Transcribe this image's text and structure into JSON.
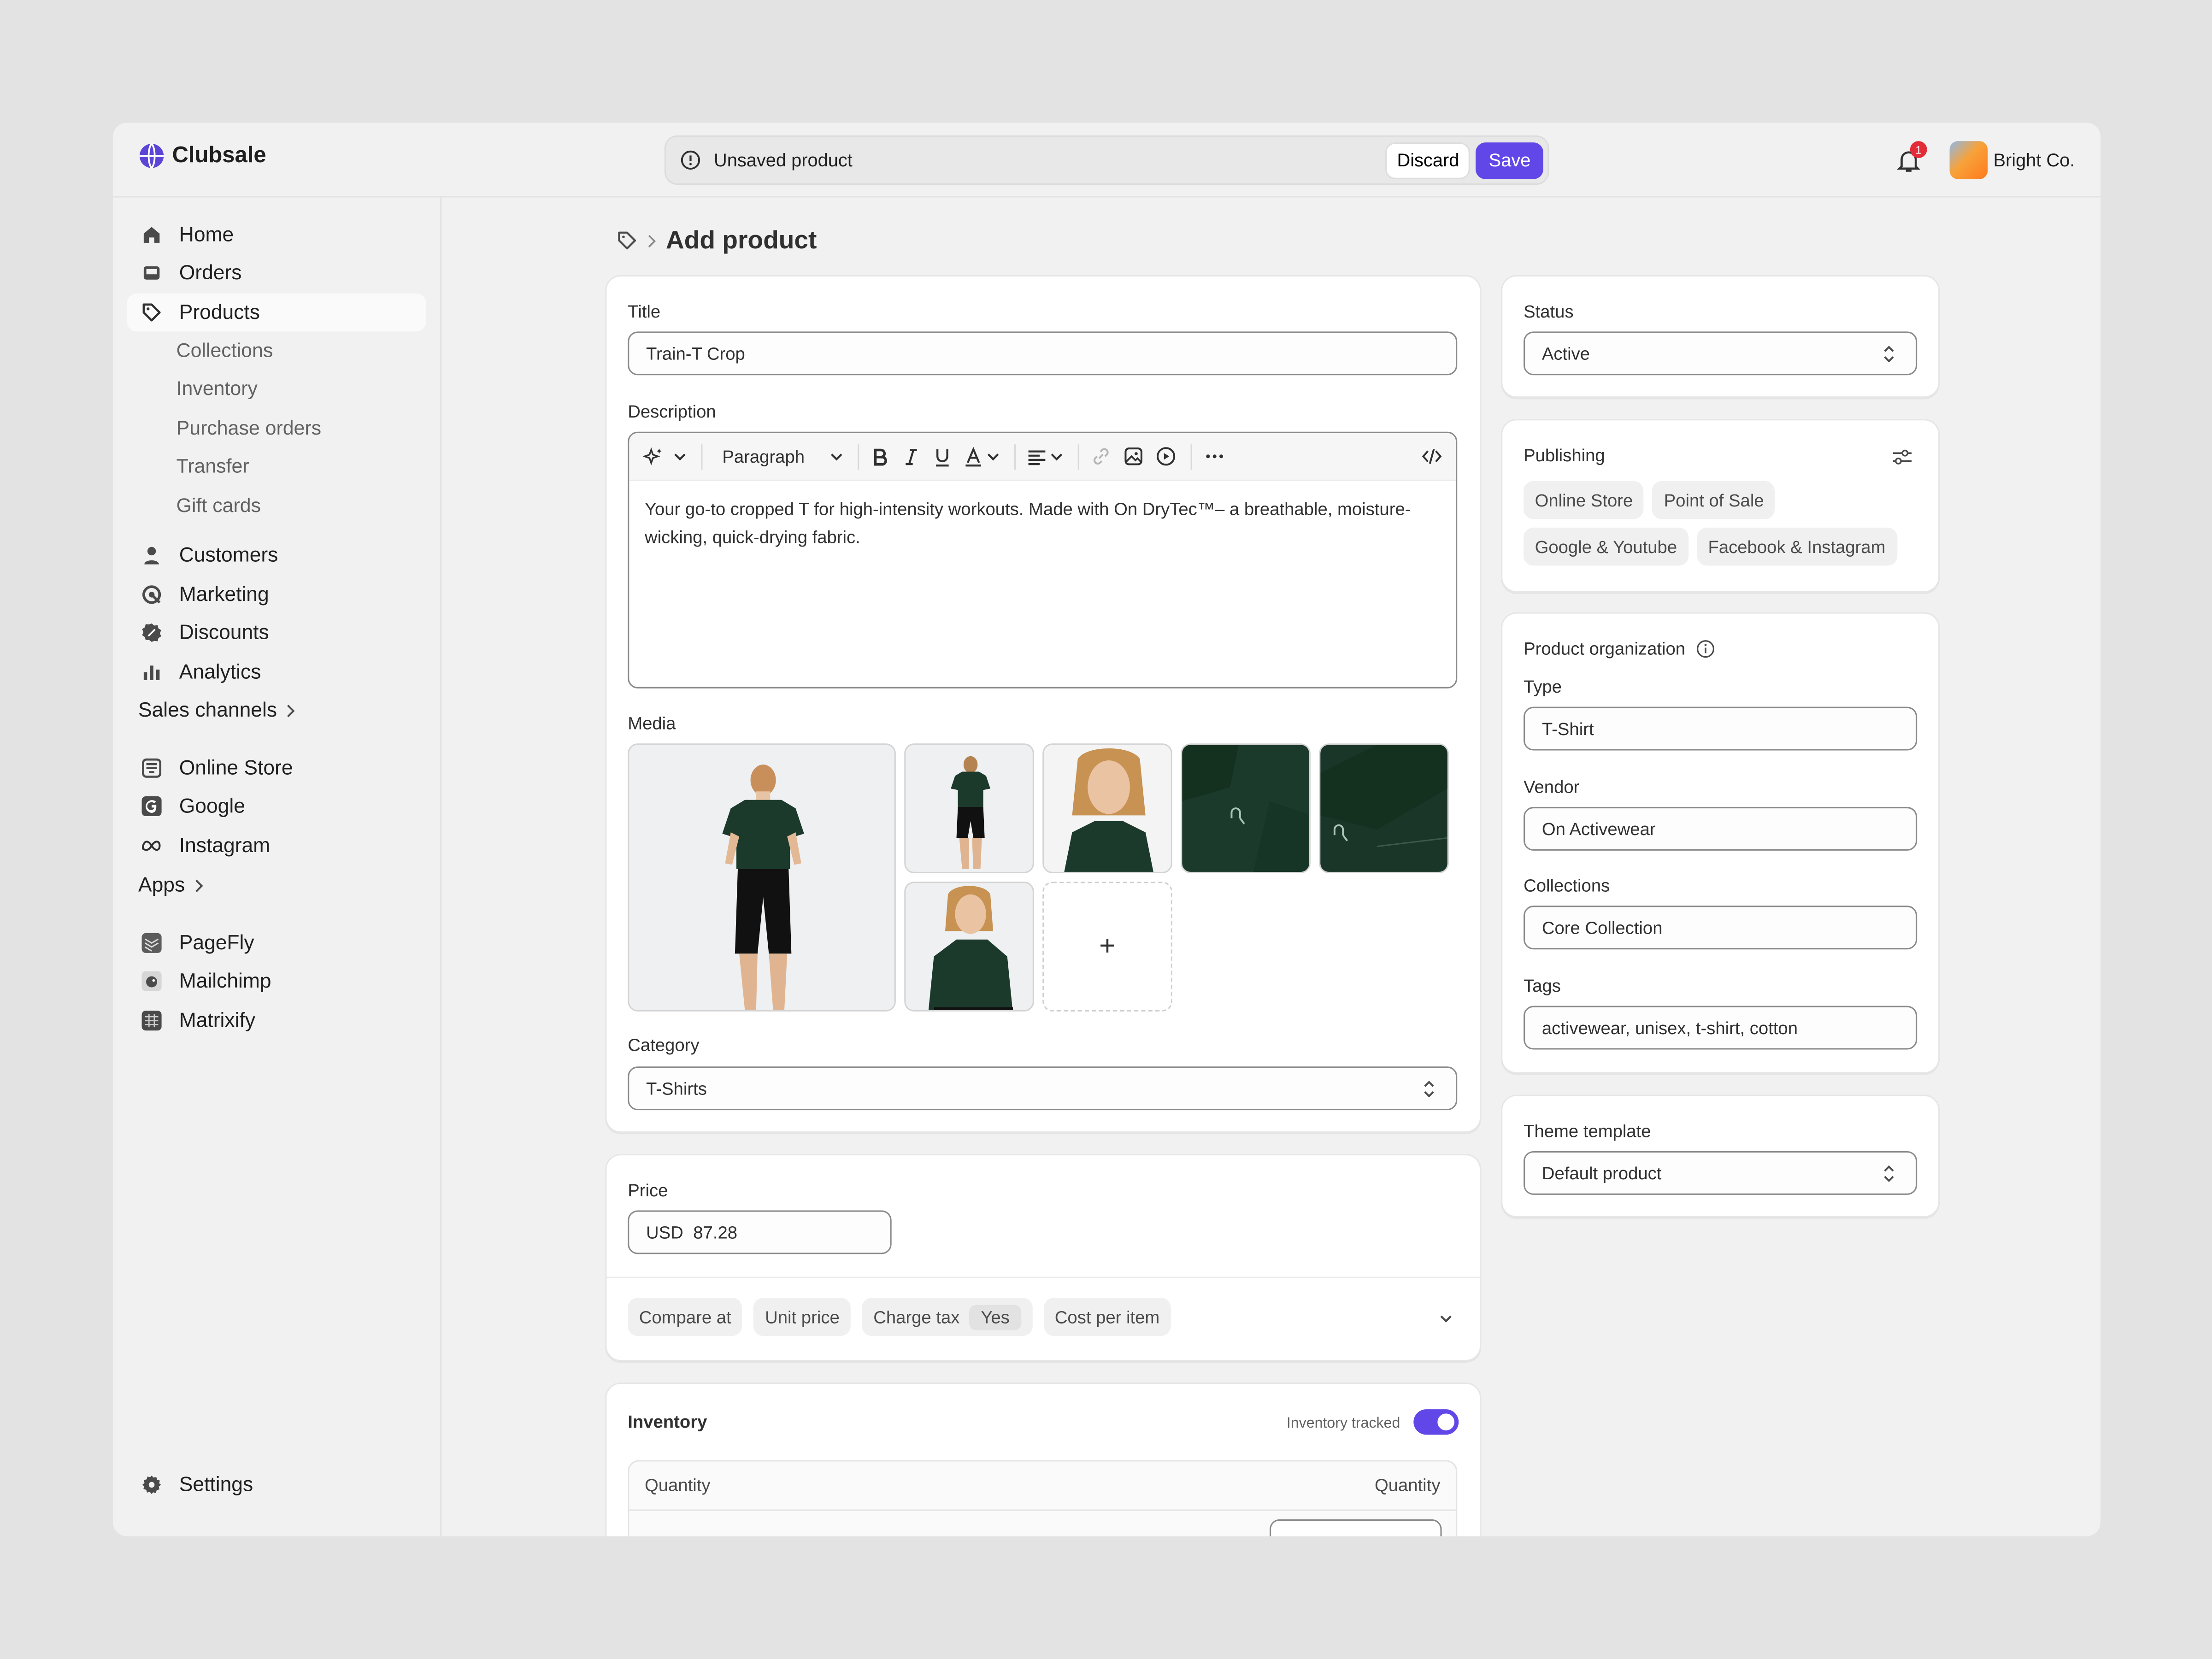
{
  "app": {
    "brand": "Clubsale"
  },
  "topbar": {
    "unsaved_text": "Unsaved product",
    "discard_label": "Discard",
    "save_label": "Save",
    "notification_count": "1",
    "account_name": "Bright Co."
  },
  "sidebar": {
    "items": [
      {
        "label": "Home",
        "icon": "home-icon"
      },
      {
        "label": "Orders",
        "icon": "inbox-icon"
      },
      {
        "label": "Products",
        "icon": "tag-icon",
        "active": true
      },
      {
        "label": "Customers",
        "icon": "person-icon"
      },
      {
        "label": "Marketing",
        "icon": "target-icon"
      },
      {
        "label": "Discounts",
        "icon": "discount-icon"
      },
      {
        "label": "Analytics",
        "icon": "bar-chart-icon"
      }
    ],
    "product_subitems": [
      "Collections",
      "Inventory",
      "Purchase orders",
      "Transfer",
      "Gift cards"
    ],
    "sales_channels_heading": "Sales channels",
    "sales_channels": [
      {
        "label": "Online Store",
        "icon": "store-icon"
      },
      {
        "label": "Google",
        "icon": "google-icon"
      },
      {
        "label": "Instagram",
        "icon": "meta-icon"
      }
    ],
    "apps_heading": "Apps",
    "apps": [
      {
        "label": "PageFly",
        "icon": "pagefly-icon"
      },
      {
        "label": "Mailchimp",
        "icon": "mailchimp-icon"
      },
      {
        "label": "Matrixify",
        "icon": "matrixify-icon"
      }
    ],
    "settings_label": "Settings"
  },
  "page": {
    "title": "Add product"
  },
  "main": {
    "title_label": "Title",
    "title_value": "Train-T Crop",
    "description_label": "Description",
    "editor": {
      "format_label": "Paragraph",
      "body": "Your go-to cropped T for high-intensity workouts. Made with On DryTec™– a breathable, moisture-wicking, quick-drying fabric."
    },
    "media_label": "Media",
    "media_add_symbol": "+",
    "category_label": "Category",
    "category_value": "T-Shirts"
  },
  "price": {
    "label": "Price",
    "currency": "USD",
    "amount": "87.28",
    "options": {
      "compare_at": "Compare at",
      "unit_price": "Unit price",
      "charge_tax": "Charge tax",
      "charge_tax_value": "Yes",
      "cost_per_item": "Cost per item"
    }
  },
  "inventory": {
    "title": "Inventory",
    "tracked_label": "Inventory tracked",
    "tracked": true,
    "col_left": "Quantity",
    "col_right": "Quantity"
  },
  "right": {
    "status_label": "Status",
    "status_value": "Active",
    "publishing_title": "Publishing",
    "publishing_channels": [
      "Online Store",
      "Point of Sale",
      "Google & Youtube",
      "Facebook & Instagram"
    ],
    "org_title": "Product organization",
    "type_label": "Type",
    "type_value": "T-Shirt",
    "vendor_label": "Vendor",
    "vendor_value": "On Activewear",
    "collections_label": "Collections",
    "collections_value": "Core Collection",
    "tags_label": "Tags",
    "tags_value": "activewear, unisex, t-shirt, cotton",
    "theme_label": "Theme template",
    "theme_value": "Default product"
  },
  "colors": {
    "accent": "#6147e8",
    "badge": "#e22c38",
    "shirt": "#1b3a2c"
  }
}
